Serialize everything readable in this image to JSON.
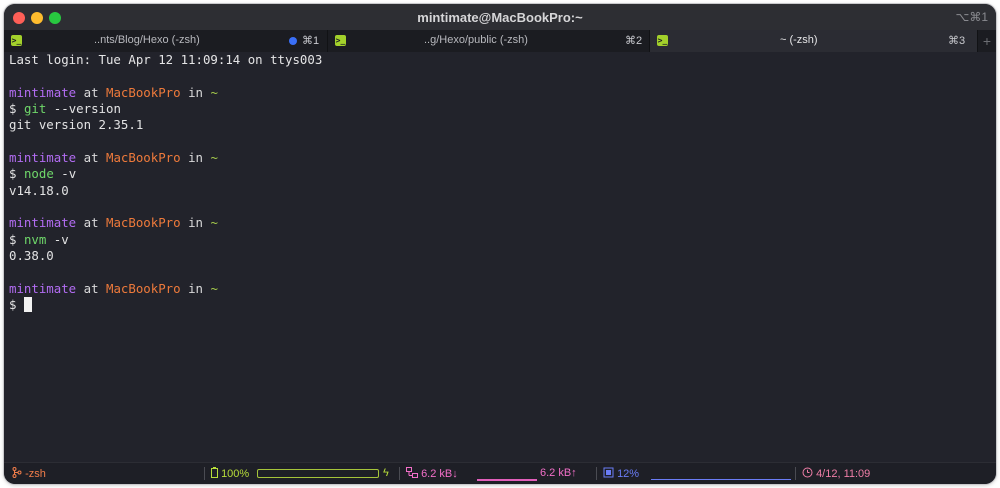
{
  "window": {
    "title": "mintimate@MacBookPro:~",
    "shortcut": "⌥⌘1"
  },
  "tabs": [
    {
      "title": "..nts/Blog/Hexo (-zsh)",
      "shortcut": "⌘1",
      "active": false,
      "has_indicator": true
    },
    {
      "title": "..g/Hexo/public (-zsh)",
      "shortcut": "⌘2",
      "active": false,
      "has_indicator": false
    },
    {
      "title": "~ (-zsh)",
      "shortcut": "⌘3",
      "active": true,
      "has_indicator": false
    }
  ],
  "tab_add_label": "+",
  "terminal": {
    "last_login": "Last login: Tue Apr 12 11:09:14 on ttys003",
    "prompt": {
      "user": "mintimate",
      "at": "at",
      "host": "MacBookPro",
      "in": "in",
      "dir": "~",
      "symbol": "$"
    },
    "commands": [
      {
        "cmd": "git",
        "args": "--version",
        "output": "git version 2.35.1"
      },
      {
        "cmd": "node",
        "args": "-v",
        "output": "v14.18.0"
      },
      {
        "cmd": "nvm",
        "args": "-v",
        "output": "0.38.0"
      }
    ]
  },
  "statusbar": {
    "shell_icon": "branch-icon",
    "shell": "-zsh",
    "battery_icon": "battery-icon",
    "battery": "100%",
    "battery_level": 1.0,
    "charging_icon": "lightning-icon",
    "charging_glyph": "ϟ",
    "network_icon": "network-icon",
    "net_down": "6.2 kB↓",
    "net_up": "6.2 kB↑",
    "cpu_icon": "cpu-icon",
    "cpu": "12%",
    "clock_icon": "clock-icon",
    "datetime": "4/12, 11:09"
  },
  "colors": {
    "background": "#22232b",
    "user": "#b26cf2",
    "host": "#ee7a3b",
    "dir": "#a6cc4b",
    "command": "#6fd86a",
    "tab_icon": "#a3d12b",
    "tab_indicator": "#3a6ff7"
  }
}
